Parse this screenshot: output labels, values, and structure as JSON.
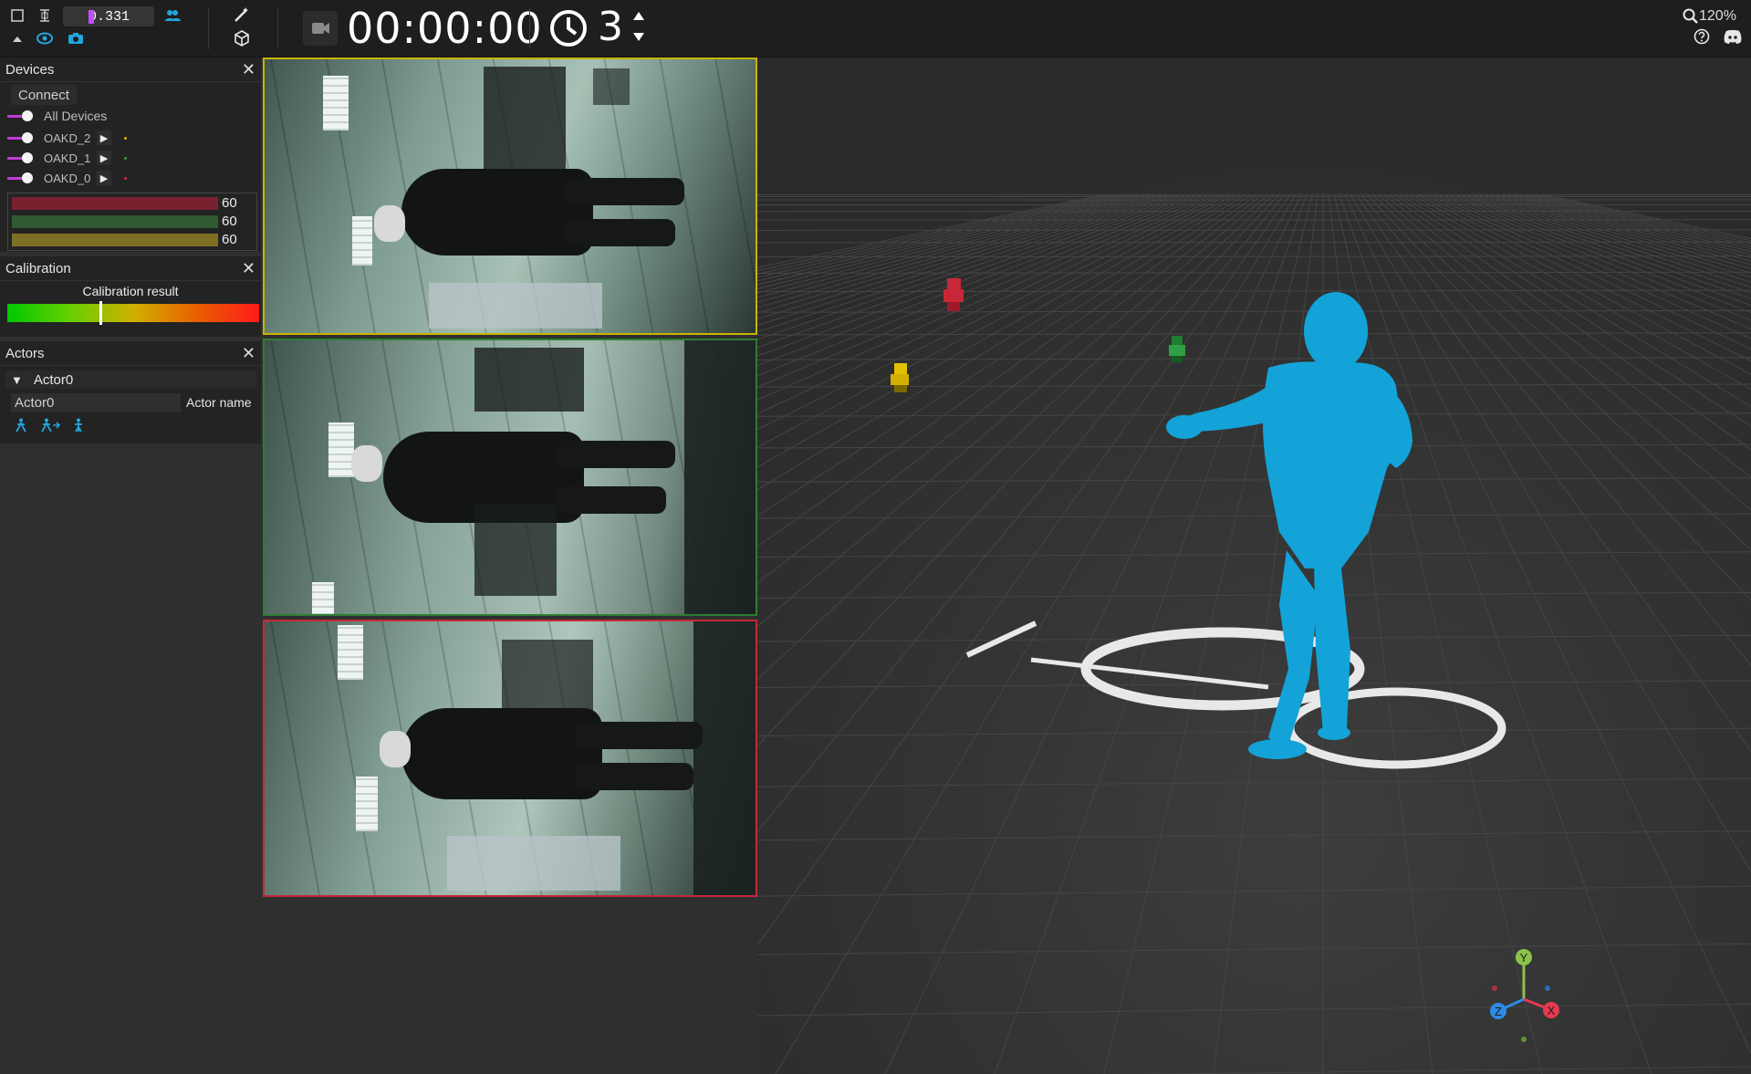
{
  "toolbar": {
    "value_field": "0.331",
    "timer": "00:00:00",
    "countdown_seconds": "3",
    "zoom_level": "120%"
  },
  "devices_panel": {
    "title": "Devices",
    "connect_label": "Connect",
    "all_devices_label": "All Devices",
    "devices": [
      {
        "name": "OAKD_2",
        "color": "#d4b000"
      },
      {
        "name": "OAKD_1",
        "color": "#2ea043"
      },
      {
        "name": "OAKD_0",
        "color": "#d0243c"
      }
    ],
    "fps": [
      {
        "value": "60",
        "color": "#7a2130"
      },
      {
        "value": "60",
        "color": "#2f5a32"
      },
      {
        "value": "60",
        "color": "#7d7024"
      }
    ]
  },
  "calibration_panel": {
    "title": "Calibration",
    "result_label": "Calibration result",
    "result_level": 0.37
  },
  "actors_panel": {
    "title": "Actors",
    "actor_tree_label": "Actor0",
    "actor_name_value": "Actor0",
    "actor_name_label": "Actor name"
  },
  "camera_feeds": [
    {
      "device": "OAKD_2",
      "border_color": "#c8b400"
    },
    {
      "device": "OAKD_1",
      "border_color": "#2e7d32"
    },
    {
      "device": "OAKD_0",
      "border_color": "#c62838"
    }
  ],
  "viewport": {
    "axis_labels": {
      "y": "Y",
      "x": "X",
      "z": "Z"
    },
    "axis_colors": {
      "y": "#8bc34a",
      "x": "#e53950",
      "z": "#2b8be6"
    },
    "avatar_color": "#13a3d8"
  }
}
